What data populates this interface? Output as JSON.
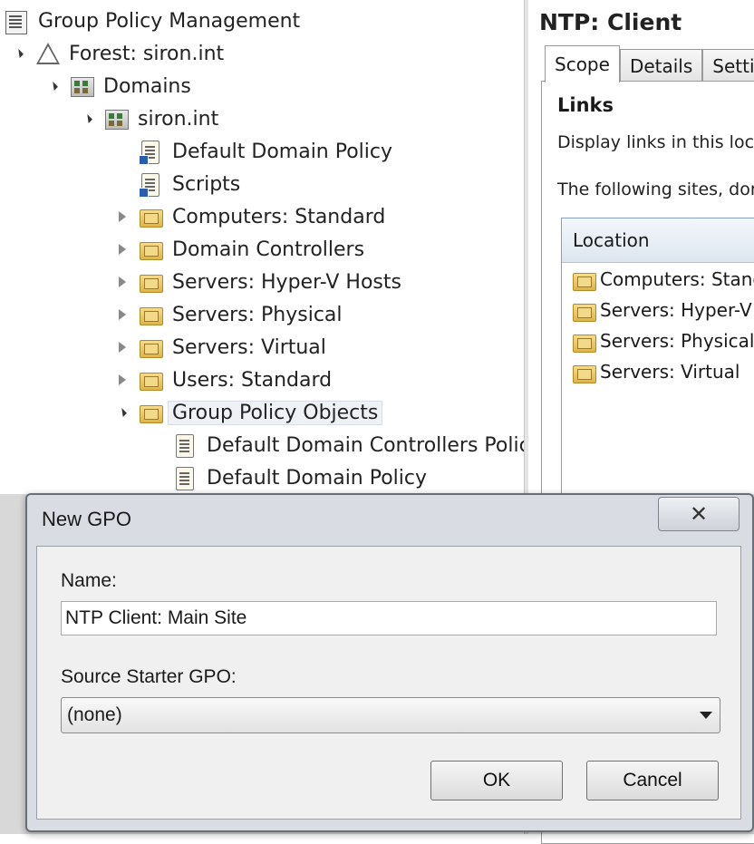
{
  "tree": {
    "root": "Group Policy Management",
    "forest": "Forest: siron.int",
    "domains": "Domains",
    "domain": "siron.int",
    "items": [
      "Default Domain Policy",
      "Scripts",
      "Computers: Standard",
      "Domain Controllers",
      "Servers: Hyper-V Hosts",
      "Servers: Physical",
      "Servers: Virtual",
      "Users: Standard",
      "Group Policy Objects"
    ],
    "gpo_children": [
      "Default Domain Controllers Polic",
      "Default Domain Policy"
    ]
  },
  "right": {
    "title": "NTP: Client",
    "tabs": [
      "Scope",
      "Details",
      "Settin"
    ],
    "links_heading": "Links",
    "display_links_text": "Display links in this loca",
    "following_text": "The following sites, dom",
    "location_header": "Location",
    "locations": [
      "Computers: Standa",
      "Servers: Hyper-V H",
      "Servers: Physical",
      "Servers: Virtual"
    ]
  },
  "dialog": {
    "title": "New GPO",
    "close_glyph": "✕",
    "name_label": "Name:",
    "name_value": "NTP Client: Main Site",
    "source_label": "Source Starter GPO:",
    "source_value": "(none)",
    "ok": "OK",
    "cancel": "Cancel"
  }
}
